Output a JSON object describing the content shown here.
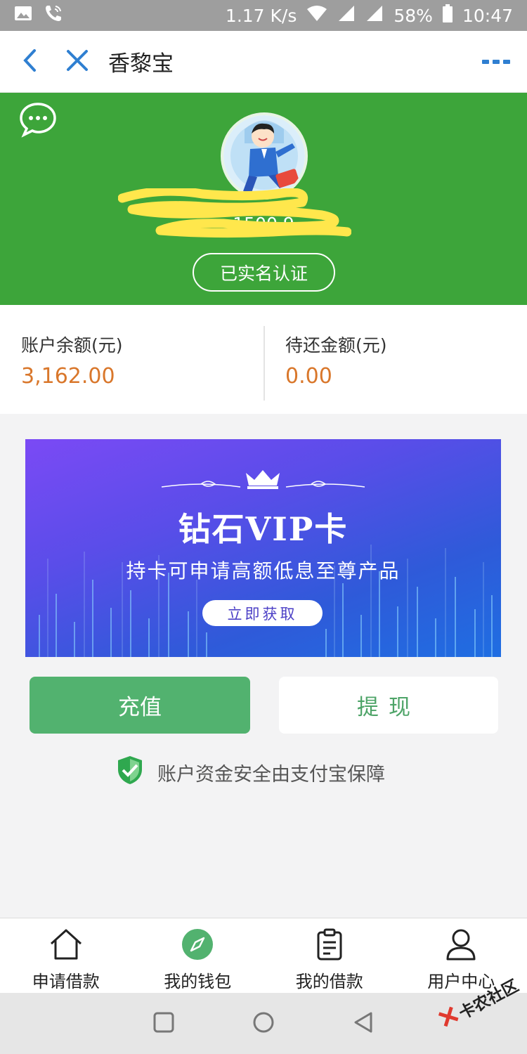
{
  "status_bar": {
    "speed": "1.17 K/s",
    "battery": "58%",
    "time": "10:47"
  },
  "nav": {
    "title": "香黎宝"
  },
  "profile": {
    "phone": "1500 9",
    "verify_label": "已实名认证"
  },
  "balances": {
    "account_label": "账户余额(元)",
    "account_value": "3,162.00",
    "due_label": "待还金额(元)",
    "due_value": "0.00"
  },
  "banner": {
    "title": "钻石VIP卡",
    "subtitle": "持卡可申请高额低息至尊产品",
    "button": "立即获取"
  },
  "actions": {
    "recharge": "充值",
    "withdraw": "提现"
  },
  "safety_note": "账户资金安全由支付宝保障",
  "tabs": [
    {
      "label": "申请借款",
      "icon": "home-icon"
    },
    {
      "label": "我的钱包",
      "icon": "compass-icon",
      "active": true
    },
    {
      "label": "我的借款",
      "icon": "document-icon"
    },
    {
      "label": "用户中心",
      "icon": "user-icon"
    }
  ],
  "watermark": "卡农社区",
  "colors": {
    "hero_green": "#3da53a",
    "primary_green": "#52b26f",
    "amount_orange": "#d9772b",
    "nav_blue": "#2f7fd1"
  }
}
